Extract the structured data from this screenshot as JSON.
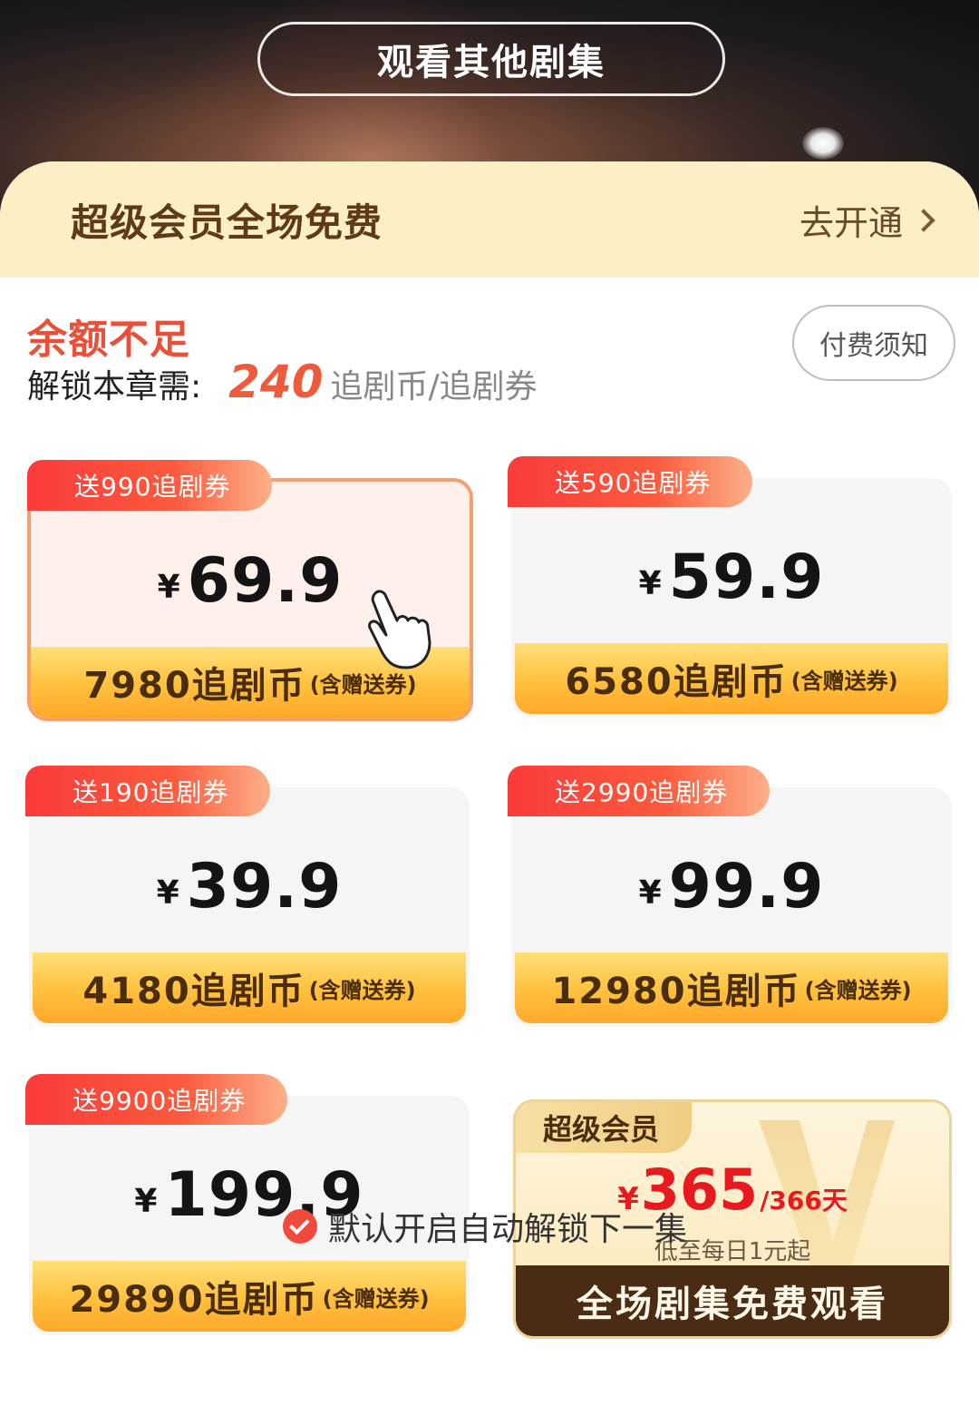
{
  "header": {
    "watch_other_label": "观看其他剧集"
  },
  "vip_banner": {
    "title": "超级会员全场免费",
    "action_label": "去开通"
  },
  "balance": {
    "status": "余额不足",
    "unlock_label": "解锁本章需:",
    "amount": "240",
    "unit": "追剧币/追剧券",
    "notice_label": "付费须知"
  },
  "packages": [
    {
      "bonus": "送990追剧券",
      "currency": "¥",
      "price": "69.9",
      "coins": "7980追剧币",
      "coins_note": "(含赠送券)",
      "selected": true
    },
    {
      "bonus": "送590追剧券",
      "currency": "¥",
      "price": "59.9",
      "coins": "6580追剧币",
      "coins_note": "(含赠送券)",
      "selected": false
    },
    {
      "bonus": "送190追剧券",
      "currency": "¥",
      "price": "39.9",
      "coins": "4180追剧币",
      "coins_note": "(含赠送券)",
      "selected": false
    },
    {
      "bonus": "送2990追剧券",
      "currency": "¥",
      "price": "99.9",
      "coins": "12980追剧币",
      "coins_note": "(含赠送券)",
      "selected": false
    },
    {
      "bonus": "送9900追剧券",
      "currency": "¥",
      "price": "199.9",
      "coins": "29890追剧币",
      "coins_note": "(含赠送券)",
      "selected": false
    }
  ],
  "super_vip": {
    "tag": "超级会员",
    "currency": "¥",
    "price": "365",
    "period": "/366天",
    "hint": "低至每日1元起",
    "cta": "全场剧集免费观看"
  },
  "auto_unlock": {
    "label": "默认开启自动解锁下一集",
    "checked": true
  },
  "colors": {
    "accent_red": "#ef4a3c",
    "price_orange": "#ef5a3a",
    "coin_bar": "#ffc03d",
    "vip_dark": "#4a2c14"
  }
}
